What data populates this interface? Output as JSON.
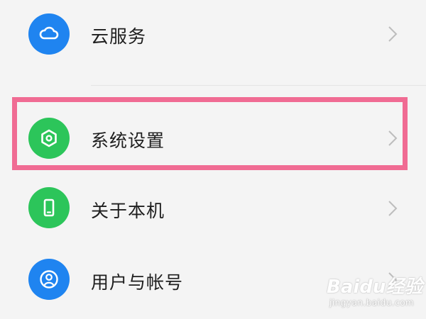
{
  "settings": {
    "items": [
      {
        "label": "云服务",
        "icon": "cloud-icon",
        "icon_color": "#1f84f0"
      },
      {
        "label": "系统设置",
        "icon": "hexagon-settings-icon",
        "icon_color": "#2cc55a"
      },
      {
        "label": "关于本机",
        "icon": "phone-icon",
        "icon_color": "#2cc55a"
      },
      {
        "label": "用户与帐号",
        "icon": "user-icon",
        "icon_color": "#1f84f0"
      }
    ]
  },
  "highlight": {
    "color": "#f06b93"
  },
  "watermark": {
    "logo": "Baidu经验",
    "url": "jingyan.baidu.com"
  }
}
